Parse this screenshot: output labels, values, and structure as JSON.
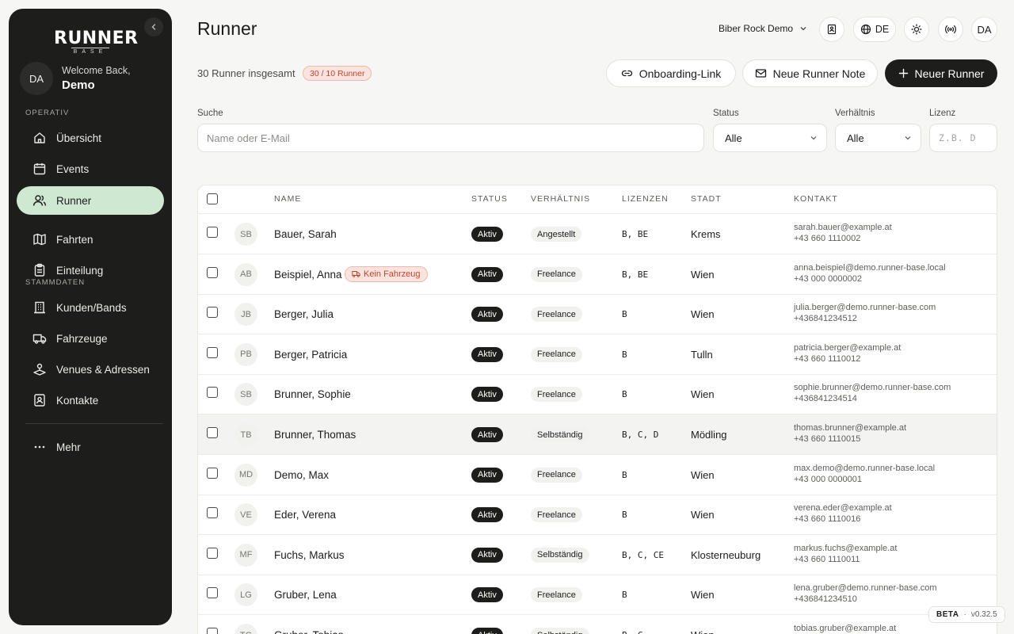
{
  "brand": {
    "logo_main": "RUNNER",
    "logo_sub": "BASE"
  },
  "user": {
    "initials": "DA",
    "welcome": "Welcome Back,",
    "name": "Demo"
  },
  "sidebar": {
    "section_operativ": "OPERATIV",
    "section_stammdaten": "STAMMDATEN",
    "items": [
      {
        "label": "Übersicht",
        "icon": "home-icon"
      },
      {
        "label": "Events",
        "icon": "calendar-icon"
      },
      {
        "label": "Runner",
        "icon": "users-icon"
      },
      {
        "label": "Fahrten",
        "icon": "map-icon"
      },
      {
        "label": "Einteilung",
        "icon": "clipboard-icon"
      },
      {
        "label": "Kunden/Bands",
        "icon": "building-icon"
      },
      {
        "label": "Fahrzeuge",
        "icon": "truck-icon"
      },
      {
        "label": "Venues & Adressen",
        "icon": "venue-icon"
      },
      {
        "label": "Kontakte",
        "icon": "contact-icon"
      },
      {
        "label": "Mehr",
        "icon": "more-icon"
      }
    ],
    "active": "Runner"
  },
  "header": {
    "title": "Runner",
    "org": "Biber Rock Demo",
    "language": "DE",
    "avatar": "DA"
  },
  "summary": {
    "count_text": "30 Runner insgesamt",
    "limit_badge": "30 / 10 Runner"
  },
  "actions": {
    "onboarding": "Onboarding-Link",
    "note": "Neue Runner Note",
    "new_runner": "Neuer Runner"
  },
  "filters": {
    "search_label": "Suche",
    "search_placeholder": "Name oder E-Mail",
    "status_label": "Status",
    "status_value": "Alle",
    "relation_label": "Verhältnis",
    "relation_value": "Alle",
    "license_label": "Lizenz",
    "license_placeholder": "Z.B. D"
  },
  "table": {
    "columns": [
      "NAME",
      "STATUS",
      "VERHÄLTNIS",
      "LIZENZEN",
      "STADT",
      "KONTAKT"
    ],
    "rows": [
      {
        "initials": "SB",
        "name": "Bauer, Sarah",
        "status": "Aktiv",
        "relation": "Angestellt",
        "licenses": "B, BE",
        "city": "Krems",
        "email": "sarah.bauer@example.at",
        "phone": "+43 660 1110002"
      },
      {
        "initials": "AB",
        "name": "Beispiel, Anna",
        "badge": "Kein Fahrzeug",
        "status": "Aktiv",
        "relation": "Freelance",
        "licenses": "B, BE",
        "city": "Wien",
        "email": "anna.beispiel@demo.runner-base.local",
        "phone": "+43 000 0000002"
      },
      {
        "initials": "JB",
        "name": "Berger, Julia",
        "status": "Aktiv",
        "relation": "Freelance",
        "licenses": "B",
        "city": "Wien",
        "email": "julia.berger@demo.runner-base.com",
        "phone": "+436841234512"
      },
      {
        "initials": "PB",
        "name": "Berger, Patricia",
        "status": "Aktiv",
        "relation": "Freelance",
        "licenses": "B",
        "city": "Tulln",
        "email": "patricia.berger@example.at",
        "phone": "+43 660 1110012"
      },
      {
        "initials": "SB",
        "name": "Brunner, Sophie",
        "status": "Aktiv",
        "relation": "Freelance",
        "licenses": "B",
        "city": "Wien",
        "email": "sophie.brunner@demo.runner-base.com",
        "phone": "+436841234514"
      },
      {
        "initials": "TB",
        "name": "Brunner, Thomas",
        "status": "Aktiv",
        "relation": "Selbständig",
        "licenses": "B, C, D",
        "city": "Mödling",
        "email": "thomas.brunner@example.at",
        "phone": "+43 660 1110015"
      },
      {
        "initials": "MD",
        "name": "Demo, Max",
        "status": "Aktiv",
        "relation": "Freelance",
        "licenses": "B",
        "city": "Wien",
        "email": "max.demo@demo.runner-base.local",
        "phone": "+43 000 0000001"
      },
      {
        "initials": "VE",
        "name": "Eder, Verena",
        "status": "Aktiv",
        "relation": "Freelance",
        "licenses": "B",
        "city": "Wien",
        "email": "verena.eder@example.at",
        "phone": "+43 660 1110016"
      },
      {
        "initials": "MF",
        "name": "Fuchs, Markus",
        "status": "Aktiv",
        "relation": "Selbständig",
        "licenses": "B, C, CE",
        "city": "Klosterneuburg",
        "email": "markus.fuchs@example.at",
        "phone": "+43 660 1110011"
      },
      {
        "initials": "LG",
        "name": "Gruber, Lena",
        "status": "Aktiv",
        "relation": "Freelance",
        "licenses": "B",
        "city": "Wien",
        "email": "lena.gruber@demo.runner-base.com",
        "phone": "+436841234510"
      },
      {
        "initials": "TG",
        "name": "Gruber, Tobias",
        "status": "Aktiv",
        "relation": "Selbständig",
        "licenses": "B, C",
        "city": "Wien",
        "email": "tobias.gruber@example.at",
        "phone": ""
      }
    ]
  },
  "version": {
    "tag": "BETA",
    "sep": "·",
    "number": "v0.32.5"
  }
}
